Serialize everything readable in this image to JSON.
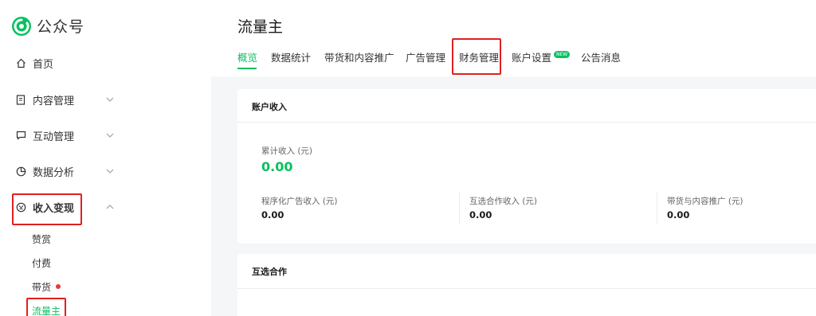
{
  "app": {
    "name": "公众号"
  },
  "sidebar": {
    "items": [
      {
        "label": "首页",
        "icon": "home-icon"
      },
      {
        "label": "内容管理",
        "icon": "document-icon"
      },
      {
        "label": "互动管理",
        "icon": "chat-icon"
      },
      {
        "label": "数据分析",
        "icon": "pie-chart-icon"
      },
      {
        "label": "收入变现",
        "icon": "coin-icon"
      }
    ],
    "income_sub": [
      {
        "label": "赞赏"
      },
      {
        "label": "付费"
      },
      {
        "label": "带货"
      },
      {
        "label": "流量主"
      }
    ]
  },
  "page": {
    "title": "流量主",
    "tabs": [
      {
        "label": "概览"
      },
      {
        "label": "数据统计"
      },
      {
        "label": "带货和内容推广"
      },
      {
        "label": "广告管理"
      },
      {
        "label": "财务管理"
      },
      {
        "label": "账户设置"
      },
      {
        "label": "公告消息"
      }
    ],
    "new_badge": "NEW"
  },
  "account_income": {
    "title": "账户收入",
    "total_label": "累计收入 (元)",
    "total_value": "0.00",
    "sub": [
      {
        "label": "程序化广告收入 (元)",
        "value": "0.00"
      },
      {
        "label": "互选合作收入 (元)",
        "value": "0.00"
      },
      {
        "label": "带货与内容推广 (元)",
        "value": "0.00"
      }
    ]
  },
  "mutual": {
    "title": "互选合作"
  },
  "colors": {
    "accent": "#07c160",
    "highlight": "#e02020",
    "dot": "#e53935"
  }
}
